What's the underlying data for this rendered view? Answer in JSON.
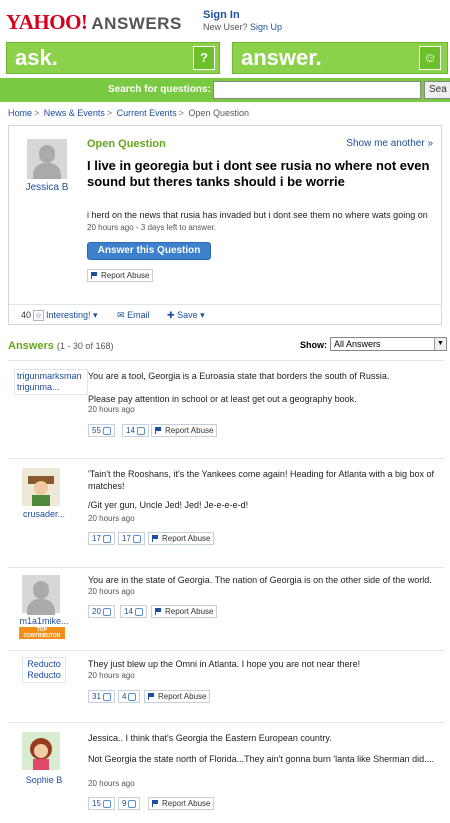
{
  "header": {
    "logo": "YAHOO!",
    "logo_suffix": "ANSWERS",
    "sign_in": "Sign In",
    "new_user": "New User?",
    "sign_up": "Sign Up"
  },
  "askbar": {
    "ask": "ask.",
    "ask_icon": "?",
    "answer": "answer.",
    "answer_icon": "☺"
  },
  "search": {
    "label": "Search for questions:",
    "button": "Sea",
    "placeholder": ""
  },
  "breadcrumb": [
    "Home",
    "News & Events",
    "Current Events",
    "Open Question"
  ],
  "question": {
    "status": "Open Question",
    "show_another": "Show me another »",
    "asker": "Jessica B",
    "title": "I live in georegia but i dont see rusia no where not even sound but theres tanks should i be worrie",
    "body": "i herd on the news that rusia has invaded but i dont see them no where wats going on",
    "meta": "20 hours ago - 3 days left to answer.",
    "answer_button": "Answer this Question",
    "report": "Report Abuse",
    "interesting_count": "40",
    "interesting_label": "Interesting!",
    "email": "Email",
    "save": "Save"
  },
  "answers_header": {
    "title": "Answers",
    "range": "(1 - 30 of 168)",
    "show_label": "Show:",
    "show_value": "All Answers"
  },
  "answers": [
    {
      "user": "trigunmarksman",
      "user_short": "trigunma...",
      "lines": [
        "You are a tool, Georgia is a Euroasia state that borders the south of Russia.",
        "Please pay attention in school or at least get out a geography book."
      ],
      "time": "20 hours ago",
      "up": "55",
      "down": "14",
      "report": "Report Abuse"
    },
    {
      "user": "crusader...",
      "lines": [
        "'Tain't the Rooshans, it's the Yankees come again! Heading for Atlanta with a big box of matches!",
        "/Git yer gun, Uncle Jed! Jed! Je-e-e-e-d!"
      ],
      "time": "20 hours ago",
      "up": "17",
      "down": "17",
      "report": "Report Abuse"
    },
    {
      "user": "m1a1mike...",
      "badge": "TOP CONTRIBUTOR",
      "lines": [
        "You are in the state of Georgia. The nation of Georgia is on the other side of the world."
      ],
      "time": "20 hours ago",
      "up": "20",
      "down": "14",
      "report": "Report Abuse"
    },
    {
      "user": "Reducto",
      "user_short": "Reducto",
      "lines": [
        "They just blew up the Omni in Atlanta. I hope you are not near there!"
      ],
      "time": "20 hours ago",
      "up": "31",
      "down": "4",
      "report": "Report Abuse"
    },
    {
      "user": "Sophie B",
      "lines": [
        "Jessica.. I think that's Georgia the Eastern European country.",
        "Not Georgia the state north of Florida...They ain't gonna burn 'lanta like Sherman did...."
      ],
      "time": "20 hours ago",
      "up": "15",
      "down": "9",
      "report": "Report Abuse"
    }
  ],
  "colors": {
    "brand_red": "#d4001e",
    "green": "#7ac943",
    "link_blue": "#1d4ea0"
  }
}
